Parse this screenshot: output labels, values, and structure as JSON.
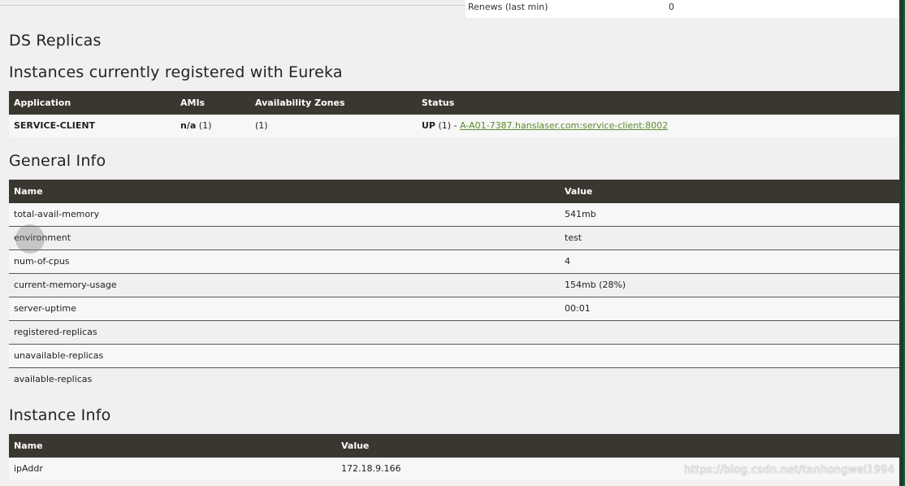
{
  "renews": {
    "label": "Renews (last min)",
    "value": "0"
  },
  "ds_replicas": {
    "title": "DS Replicas"
  },
  "instances": {
    "title": "Instances currently registered with Eureka",
    "headers": {
      "application": "Application",
      "amis": "AMIs",
      "zones": "Availability Zones",
      "status": "Status"
    },
    "rows": [
      {
        "application": "SERVICE-CLIENT",
        "amis_bold": "n/a",
        "amis_count": "(1)",
        "zones": "(1)",
        "status_bold": "UP",
        "status_count": "(1) -",
        "status_link": "A-A01-7387.hanslaser.com:service-client:8002"
      }
    ]
  },
  "general_info": {
    "title": "General Info",
    "headers": {
      "name": "Name",
      "value": "Value"
    },
    "rows": [
      {
        "name": "total-avail-memory",
        "value": "541mb"
      },
      {
        "name": "environment",
        "value": "test"
      },
      {
        "name": "num-of-cpus",
        "value": "4"
      },
      {
        "name": "current-memory-usage",
        "value": "154mb (28%)"
      },
      {
        "name": "server-uptime",
        "value": "00:01"
      },
      {
        "name": "registered-replicas",
        "value": ""
      },
      {
        "name": "unavailable-replicas",
        "value": ""
      },
      {
        "name": "available-replicas",
        "value": ""
      }
    ]
  },
  "instance_info": {
    "title": "Instance Info",
    "headers": {
      "name": "Name",
      "value": "Value"
    },
    "rows": [
      {
        "name": "ipAddr",
        "value": "172.18.9.166"
      }
    ]
  },
  "watermark": "https://blog.csdn.net/tanhongwei1994"
}
